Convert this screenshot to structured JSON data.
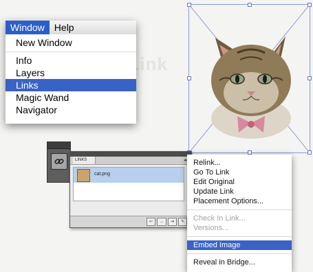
{
  "background": {
    "faded_text": "New Images Link"
  },
  "menubar": {
    "items": [
      "Window",
      "Help"
    ],
    "active": "Window"
  },
  "window_menu": {
    "group1": [
      "New Window"
    ],
    "group2": [
      "Info",
      "Layers",
      "Links",
      "Magic Wand",
      "Navigator"
    ],
    "selected": "Links"
  },
  "links_panel": {
    "tab_label": "LINKS",
    "collapse_glyph": "◂◂",
    "file_name": "cat.png",
    "buttons": [
      "↩",
      "→",
      "⇥",
      "✎"
    ]
  },
  "context_menu": {
    "group1": [
      "Relink...",
      "Go To Link",
      "Edit Original",
      "Update Link",
      "Placement Options..."
    ],
    "group2_disabled": [
      "Check In Link...",
      "Versions..."
    ],
    "group3": [
      "Embed Image"
    ],
    "group4": [
      "Reveal in Bridge..."
    ],
    "selected": "Embed Image"
  },
  "colors": {
    "selection_blue": "#3862c6",
    "frame_blue": "#8a9ad8",
    "panel_dark": "#5e5e5e"
  }
}
